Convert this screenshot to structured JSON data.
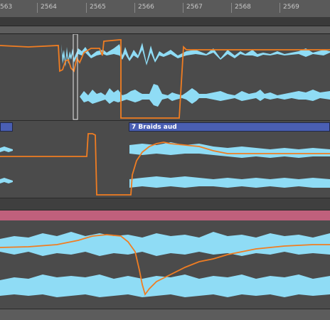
{
  "ruler": {
    "ticks": [
      {
        "label": "563"
      },
      {
        "label": "2564"
      },
      {
        "label": "2565"
      },
      {
        "label": "2566"
      },
      {
        "label": "2567"
      },
      {
        "label": "2568"
      },
      {
        "label": "2569"
      }
    ]
  },
  "tracks": [
    {
      "clip_label": ""
    },
    {
      "clip_label": "",
      "clip2_label": "7 Braids aud"
    },
    {
      "clip_label": ""
    }
  ],
  "colors": {
    "waveform": "#8fdcf5",
    "automation": "#f07d22",
    "clip_header": "#4a5fb3",
    "marker_strip": "#c0607c",
    "lane_bg": "#4b4b4b"
  }
}
